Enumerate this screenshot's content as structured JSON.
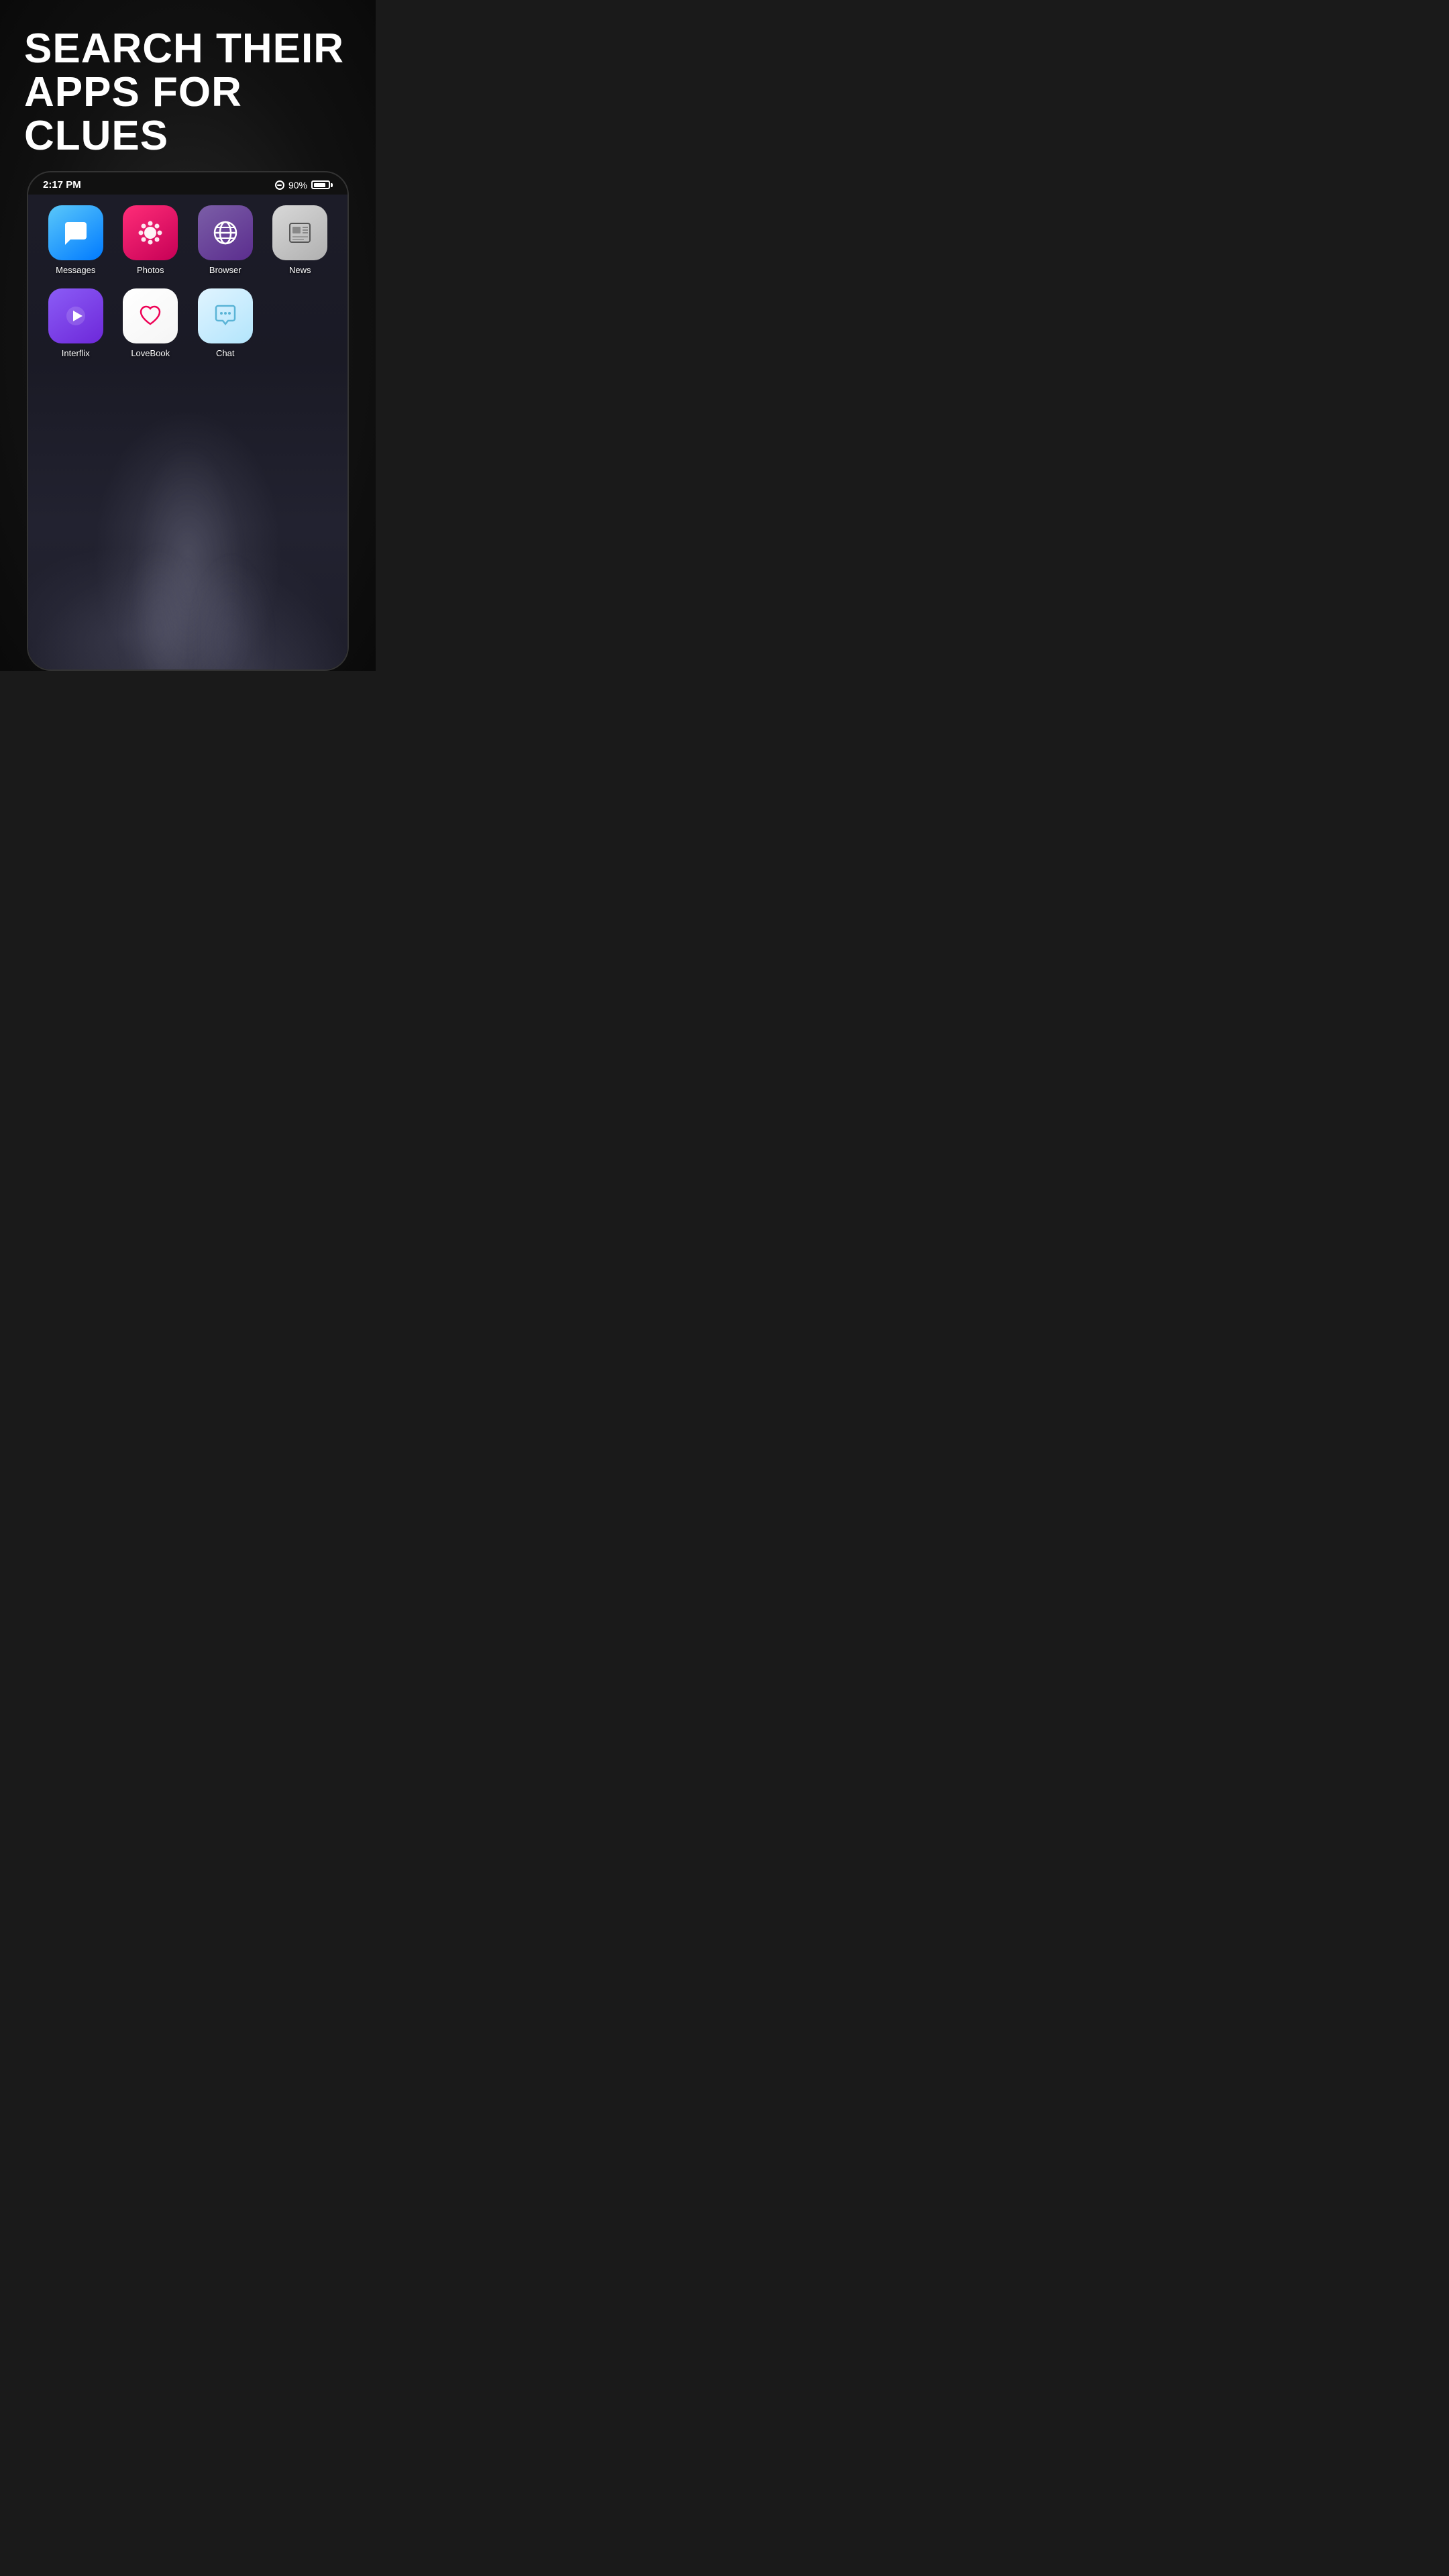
{
  "page": {
    "background": "#1a1a1a",
    "headline_line1": "SEARCH THEIR",
    "headline_line2": "APPS FOR CLUES"
  },
  "status_bar": {
    "time": "2:17 PM",
    "battery_percent": "90%"
  },
  "apps_row1": [
    {
      "id": "messages",
      "label": "Messages",
      "icon_type": "messages"
    },
    {
      "id": "photos",
      "label": "Photos",
      "icon_type": "photos"
    },
    {
      "id": "browser",
      "label": "Browser",
      "icon_type": "browser"
    },
    {
      "id": "news",
      "label": "News",
      "icon_type": "news"
    }
  ],
  "apps_row2": [
    {
      "id": "interflix",
      "label": "Interflix",
      "icon_type": "interflix"
    },
    {
      "id": "lovebook",
      "label": "LoveBook",
      "icon_type": "lovebook"
    },
    {
      "id": "chat",
      "label": "Chat",
      "icon_type": "chat"
    }
  ]
}
